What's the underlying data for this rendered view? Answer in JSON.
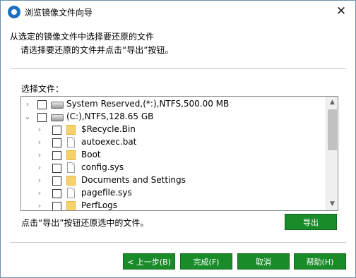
{
  "window": {
    "title": "浏览镜像文件向导",
    "close_glyph": "✕"
  },
  "intro": {
    "line1": "从选定的镜像文件中选择要还原的文件",
    "line2": "请选择要还原的文件并点击“导出”按钮。"
  },
  "tree": {
    "label": "选择文件：",
    "items": [
      {
        "label": "System Reserved,(*:),NTFS,500.00 MB",
        "icon": "disk-icon",
        "expander": "›"
      },
      {
        "label": "(C:),NTFS,128.65 GB",
        "icon": "disk-icon",
        "expander": "⌄"
      },
      {
        "label": "$Recycle.Bin",
        "icon": "folder-icon",
        "expander": "›"
      },
      {
        "label": "autoexec.bat",
        "icon": "file-icon",
        "expander": "›"
      },
      {
        "label": "Boot",
        "icon": "folder-icon",
        "expander": "›"
      },
      {
        "label": "config.sys",
        "icon": "file-icon",
        "expander": "›"
      },
      {
        "label": "Documents and Settings",
        "icon": "folder-icon",
        "expander": "›"
      },
      {
        "label": "pagefile.sys",
        "icon": "file-icon",
        "expander": "›"
      },
      {
        "label": "PerfLogs",
        "icon": "folder-icon",
        "expander": "›"
      }
    ]
  },
  "hint": "点击“导出”按钮还原选中的文件。",
  "buttons": {
    "export": "导出",
    "back": "< 上一步(B)",
    "finish": "完成(F)",
    "cancel": "取消",
    "help": "帮助(H)"
  },
  "colors": {
    "accent": "#198b29"
  }
}
